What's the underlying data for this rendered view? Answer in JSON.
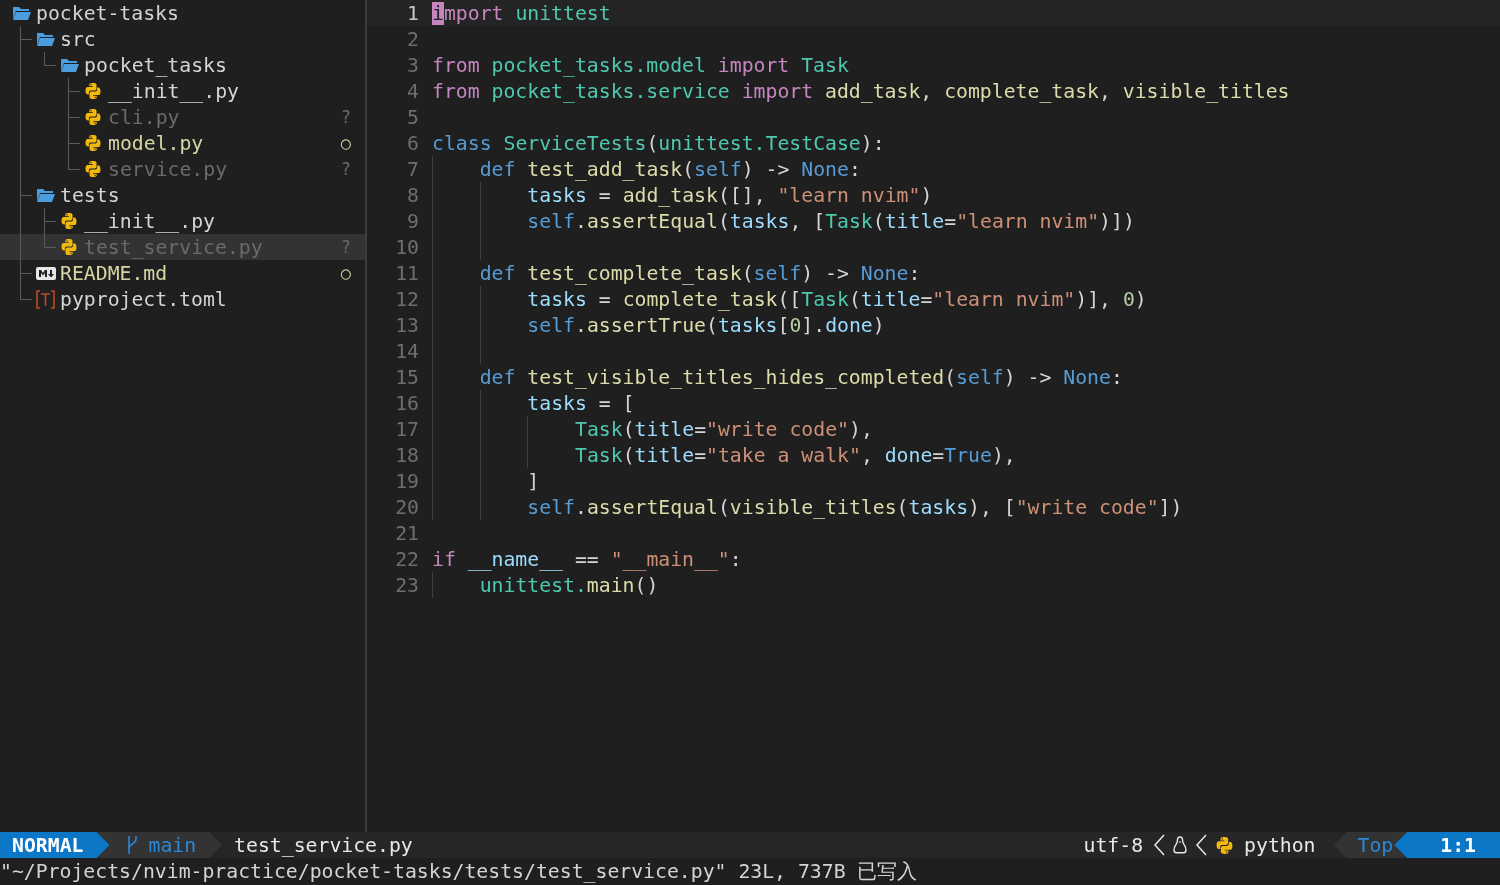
{
  "explorer": {
    "tree": [
      {
        "name": "pocket-tasks",
        "kind": "folder",
        "expanded": true,
        "selected": false,
        "untracked": false,
        "modified": false,
        "children": [
          {
            "name": "src",
            "kind": "folder",
            "expanded": true,
            "selected": false,
            "untracked": false,
            "modified": false,
            "children": [
              {
                "name": "pocket_tasks",
                "kind": "folder",
                "expanded": true,
                "selected": false,
                "untracked": false,
                "modified": false,
                "children": [
                  {
                    "name": "__init__.py",
                    "kind": "python",
                    "selected": false,
                    "untracked": false,
                    "modified": false
                  },
                  {
                    "name": "cli.py",
                    "kind": "python",
                    "selected": false,
                    "untracked": true,
                    "modified": false,
                    "status": "?"
                  },
                  {
                    "name": "model.py",
                    "kind": "python",
                    "selected": false,
                    "untracked": false,
                    "modified": true,
                    "status": "○"
                  },
                  {
                    "name": "service.py",
                    "kind": "python",
                    "selected": false,
                    "untracked": true,
                    "modified": false,
                    "status": "?"
                  }
                ]
              }
            ]
          },
          {
            "name": "tests",
            "kind": "folder",
            "expanded": true,
            "selected": false,
            "untracked": false,
            "modified": false,
            "children": [
              {
                "name": "__init__.py",
                "kind": "python",
                "selected": false,
                "untracked": false,
                "modified": false
              },
              {
                "name": "test_service.py",
                "kind": "python",
                "selected": true,
                "untracked": true,
                "modified": false,
                "status": "?"
              }
            ]
          },
          {
            "name": "README.md",
            "kind": "markdown",
            "selected": false,
            "untracked": false,
            "modified": true,
            "status": "○"
          },
          {
            "name": "pyproject.toml",
            "kind": "toml",
            "selected": false,
            "untracked": false,
            "modified": false
          }
        ]
      }
    ]
  },
  "editor": {
    "lines": [
      {
        "number": "1",
        "current": true,
        "tokens": [
          {
            "kind": "cursor",
            "text": "i"
          },
          {
            "kind": "kw",
            "text": "mport "
          },
          {
            "kind": "mod",
            "text": "unittest"
          }
        ]
      },
      {
        "number": "2",
        "current": false
      },
      {
        "number": "3",
        "current": false,
        "tokens": [
          {
            "kind": "kw",
            "text": "from "
          },
          {
            "kind": "mod",
            "text": "pocket_tasks.model "
          },
          {
            "kind": "kw",
            "text": "import "
          },
          {
            "kind": "mod",
            "text": "Task"
          }
        ]
      },
      {
        "number": "4",
        "current": false,
        "tokens": [
          {
            "kind": "kw",
            "text": "from "
          },
          {
            "kind": "mod",
            "text": "pocket_tasks.service "
          },
          {
            "kind": "kw",
            "text": "import "
          },
          {
            "kind": "fn",
            "text": "add_task"
          },
          {
            "kind": "p",
            "text": ", "
          },
          {
            "kind": "fn",
            "text": "complete_task"
          },
          {
            "kind": "p",
            "text": ", "
          },
          {
            "kind": "fn",
            "text": "visible_titles"
          }
        ]
      },
      {
        "number": "5",
        "current": false
      },
      {
        "number": "6",
        "current": false,
        "tokens": [
          {
            "kind": "blue",
            "text": "class "
          },
          {
            "kind": "mod",
            "text": "ServiceTests"
          },
          {
            "kind": "p",
            "text": "("
          },
          {
            "kind": "mod",
            "text": "unittest.TestCase"
          },
          {
            "kind": "p",
            "text": "):"
          }
        ]
      },
      {
        "number": "7",
        "current": false,
        "tokens": [
          {
            "kind": "blue",
            "text": "    def "
          },
          {
            "kind": "fn",
            "text": "test_add_task"
          },
          {
            "kind": "p",
            "text": "("
          },
          {
            "kind": "blue",
            "text": "self"
          },
          {
            "kind": "p",
            "text": ") -> "
          },
          {
            "kind": "blue",
            "text": "None"
          },
          {
            "kind": "p",
            "text": ":"
          }
        ]
      },
      {
        "number": "8",
        "current": false,
        "tokens": [
          {
            "kind": "var",
            "text": "        tasks"
          },
          {
            "kind": "p",
            "text": " = "
          },
          {
            "kind": "fn",
            "text": "add_task"
          },
          {
            "kind": "p",
            "text": "([], "
          },
          {
            "kind": "str",
            "text": "\"learn nvim\""
          },
          {
            "kind": "p",
            "text": ")"
          }
        ]
      },
      {
        "number": "9",
        "current": false,
        "tokens": [
          {
            "kind": "blue",
            "text": "        self"
          },
          {
            "kind": "p",
            "text": "."
          },
          {
            "kind": "fn",
            "text": "assertEqual"
          },
          {
            "kind": "p",
            "text": "("
          },
          {
            "kind": "var",
            "text": "tasks"
          },
          {
            "kind": "p",
            "text": ", ["
          },
          {
            "kind": "mod",
            "text": "Task"
          },
          {
            "kind": "p",
            "text": "("
          },
          {
            "kind": "var",
            "text": "title"
          },
          {
            "kind": "p",
            "text": "="
          },
          {
            "kind": "str",
            "text": "\"learn nvim\""
          },
          {
            "kind": "p",
            "text": ")])"
          }
        ]
      },
      {
        "number": "10",
        "current": false
      },
      {
        "number": "11",
        "current": false,
        "tokens": [
          {
            "kind": "blue",
            "text": "    def "
          },
          {
            "kind": "fn",
            "text": "test_complete_task"
          },
          {
            "kind": "p",
            "text": "("
          },
          {
            "kind": "blue",
            "text": "self"
          },
          {
            "kind": "p",
            "text": ") -> "
          },
          {
            "kind": "blue",
            "text": "None"
          },
          {
            "kind": "p",
            "text": ":"
          }
        ]
      },
      {
        "number": "12",
        "current": false,
        "tokens": [
          {
            "kind": "var",
            "text": "        tasks"
          },
          {
            "kind": "p",
            "text": " = "
          },
          {
            "kind": "fn",
            "text": "complete_task"
          },
          {
            "kind": "p",
            "text": "(["
          },
          {
            "kind": "mod",
            "text": "Task"
          },
          {
            "kind": "p",
            "text": "("
          },
          {
            "kind": "var",
            "text": "title"
          },
          {
            "kind": "p",
            "text": "="
          },
          {
            "kind": "str",
            "text": "\"learn nvim\""
          },
          {
            "kind": "p",
            "text": ")], "
          },
          {
            "kind": "num",
            "text": "0"
          },
          {
            "kind": "p",
            "text": ")"
          }
        ]
      },
      {
        "number": "13",
        "current": false,
        "tokens": [
          {
            "kind": "blue",
            "text": "        self"
          },
          {
            "kind": "p",
            "text": "."
          },
          {
            "kind": "fn",
            "text": "assertTrue"
          },
          {
            "kind": "p",
            "text": "("
          },
          {
            "kind": "var",
            "text": "tasks"
          },
          {
            "kind": "p",
            "text": "["
          },
          {
            "kind": "num",
            "text": "0"
          },
          {
            "kind": "p",
            "text": "]."
          },
          {
            "kind": "var",
            "text": "done"
          },
          {
            "kind": "p",
            "text": ")"
          }
        ]
      },
      {
        "number": "14",
        "current": false
      },
      {
        "number": "15",
        "current": false,
        "tokens": [
          {
            "kind": "blue",
            "text": "    def "
          },
          {
            "kind": "fn",
            "text": "test_visible_titles_hides_completed"
          },
          {
            "kind": "p",
            "text": "("
          },
          {
            "kind": "blue",
            "text": "self"
          },
          {
            "kind": "p",
            "text": ") -> "
          },
          {
            "kind": "blue",
            "text": "None"
          },
          {
            "kind": "p",
            "text": ":"
          }
        ]
      },
      {
        "number": "16",
        "current": false,
        "tokens": [
          {
            "kind": "var",
            "text": "        tasks"
          },
          {
            "kind": "p",
            "text": " = ["
          }
        ]
      },
      {
        "number": "17",
        "current": false,
        "tokens": [
          {
            "kind": "mod",
            "text": "            Task"
          },
          {
            "kind": "p",
            "text": "("
          },
          {
            "kind": "var",
            "text": "title"
          },
          {
            "kind": "p",
            "text": "="
          },
          {
            "kind": "str",
            "text": "\"write code\""
          },
          {
            "kind": "p",
            "text": "),"
          }
        ]
      },
      {
        "number": "18",
        "current": false,
        "tokens": [
          {
            "kind": "mod",
            "text": "            Task"
          },
          {
            "kind": "p",
            "text": "("
          },
          {
            "kind": "var",
            "text": "title"
          },
          {
            "kind": "p",
            "text": "="
          },
          {
            "kind": "str",
            "text": "\"take a walk\""
          },
          {
            "kind": "p",
            "text": ", "
          },
          {
            "kind": "var",
            "text": "done"
          },
          {
            "kind": "p",
            "text": "="
          },
          {
            "kind": "blue",
            "text": "True"
          },
          {
            "kind": "p",
            "text": "),"
          }
        ]
      },
      {
        "number": "19",
        "current": false,
        "tokens": [
          {
            "kind": "p",
            "text": "        ]"
          }
        ]
      },
      {
        "number": "20",
        "current": false,
        "tokens": [
          {
            "kind": "blue",
            "text": "        self"
          },
          {
            "kind": "p",
            "text": "."
          },
          {
            "kind": "fn",
            "text": "assertEqual"
          },
          {
            "kind": "p",
            "text": "("
          },
          {
            "kind": "fn",
            "text": "visible_titles"
          },
          {
            "kind": "p",
            "text": "("
          },
          {
            "kind": "var",
            "text": "tasks"
          },
          {
            "kind": "p",
            "text": "), ["
          },
          {
            "kind": "str",
            "text": "\"write code\""
          },
          {
            "kind": "p",
            "text": "])"
          }
        ]
      },
      {
        "number": "21",
        "current": false
      },
      {
        "number": "22",
        "current": false,
        "tokens": [
          {
            "kind": "kw",
            "text": "if "
          },
          {
            "kind": "var",
            "text": "__name__"
          },
          {
            "kind": "p",
            "text": " == "
          },
          {
            "kind": "str",
            "text": "\"__main__\""
          },
          {
            "kind": "p",
            "text": ":"
          }
        ]
      },
      {
        "number": "23",
        "current": false,
        "tokens": [
          {
            "kind": "mod",
            "text": "    unittest."
          },
          {
            "kind": "fn",
            "text": "main"
          },
          {
            "kind": "p",
            "text": "()"
          }
        ]
      }
    ]
  },
  "status_bar": {
    "mode": "NORMAL",
    "branch": "main",
    "file": "test_service.py",
    "encoding": "utf-8",
    "filetype": "python",
    "scroll": "Top",
    "position": "1:1"
  },
  "command_line": "\"~/Projects/nvim-practice/pocket-tasks/tests/test_service.py\" 23L, 737B 已写入"
}
